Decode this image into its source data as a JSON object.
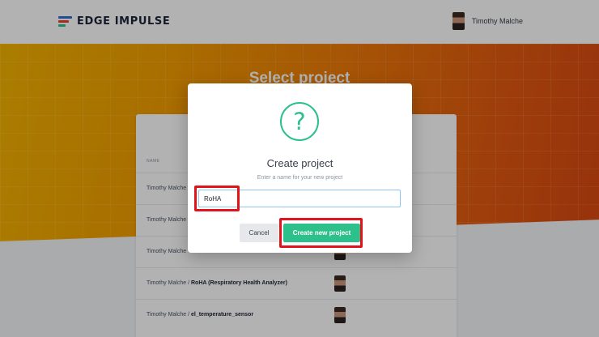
{
  "header": {
    "brand": "EDGE IMPULSE",
    "user_name": "Timothy Malche"
  },
  "hero": {
    "title": "Select project"
  },
  "projects_table": {
    "column_name": "NAME",
    "rows": [
      {
        "owner": "Timothy Malche",
        "project": ""
      },
      {
        "owner": "Timothy Malche",
        "project": ""
      },
      {
        "owner": "Timothy Malche",
        "project": ""
      },
      {
        "owner": "Timothy Malche",
        "project": "RoHA (Respiratory Health Analyzer)"
      },
      {
        "owner": "Timothy Malche",
        "project": "el_temperature_sensor"
      }
    ]
  },
  "modal": {
    "icon": "question-icon",
    "title": "Create project",
    "subtitle": "Enter a name for your new project",
    "input_value": "RoHA",
    "cancel_label": "Cancel",
    "create_label": "Create new project"
  },
  "colors": {
    "accent_green": "#2dc08a",
    "highlight_red": "#e0141a",
    "hero_orange": "#ee7a08"
  }
}
